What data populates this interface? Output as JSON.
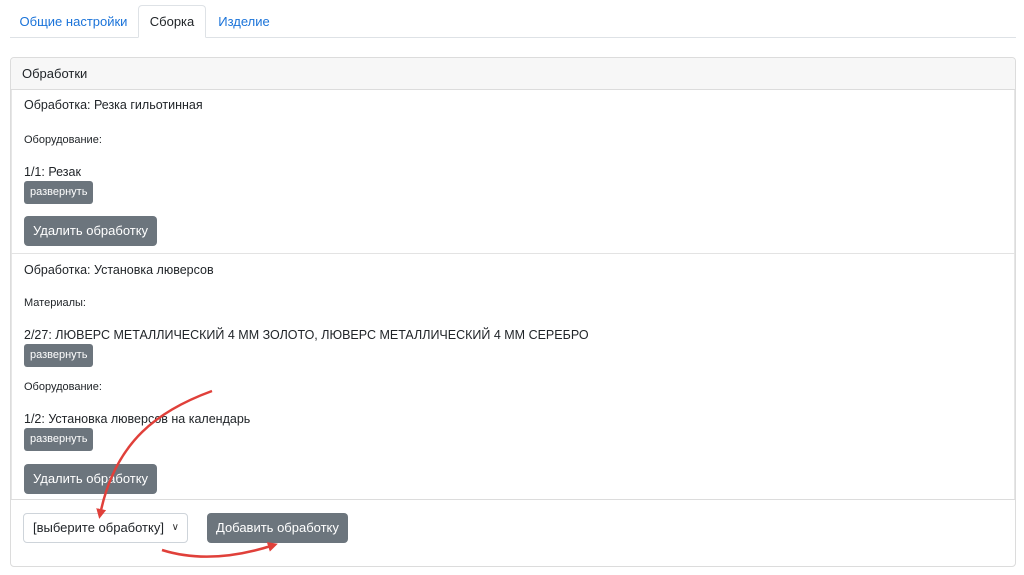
{
  "tabs": [
    {
      "label": "Общие настройки"
    },
    {
      "label": "Сборка"
    },
    {
      "label": "Изделие"
    }
  ],
  "card": {
    "header": "Обработки",
    "operations": [
      {
        "title": "Обработка: Резка гильотинная",
        "equipment_label": "Оборудование:",
        "equipment_value": "1/1: Резак",
        "expand_label": "развернуть",
        "delete_label": "Удалить обработку"
      },
      {
        "title": "Обработка: Установка люверсов",
        "materials_label": "Материалы:",
        "materials_value": "2/27: ЛЮВЕРС МЕТАЛЛИЧЕСКИЙ 4 ММ ЗОЛОТО, ЛЮВЕРС МЕТАЛЛИЧЕСКИЙ 4 ММ СЕРЕБРО",
        "materials_expand_label": "развернуть",
        "equipment_label": "Оборудование:",
        "equipment_value": "1/2: Установка люверсов на календарь",
        "equipment_expand_label": "развернуть",
        "delete_label": "Удалить обработку"
      }
    ],
    "select": {
      "value": "[выберите обработку]",
      "chevron_icon": "chevron-down-icon"
    },
    "add_label": "Добавить обработку"
  },
  "annotation_color": "#e0403a"
}
